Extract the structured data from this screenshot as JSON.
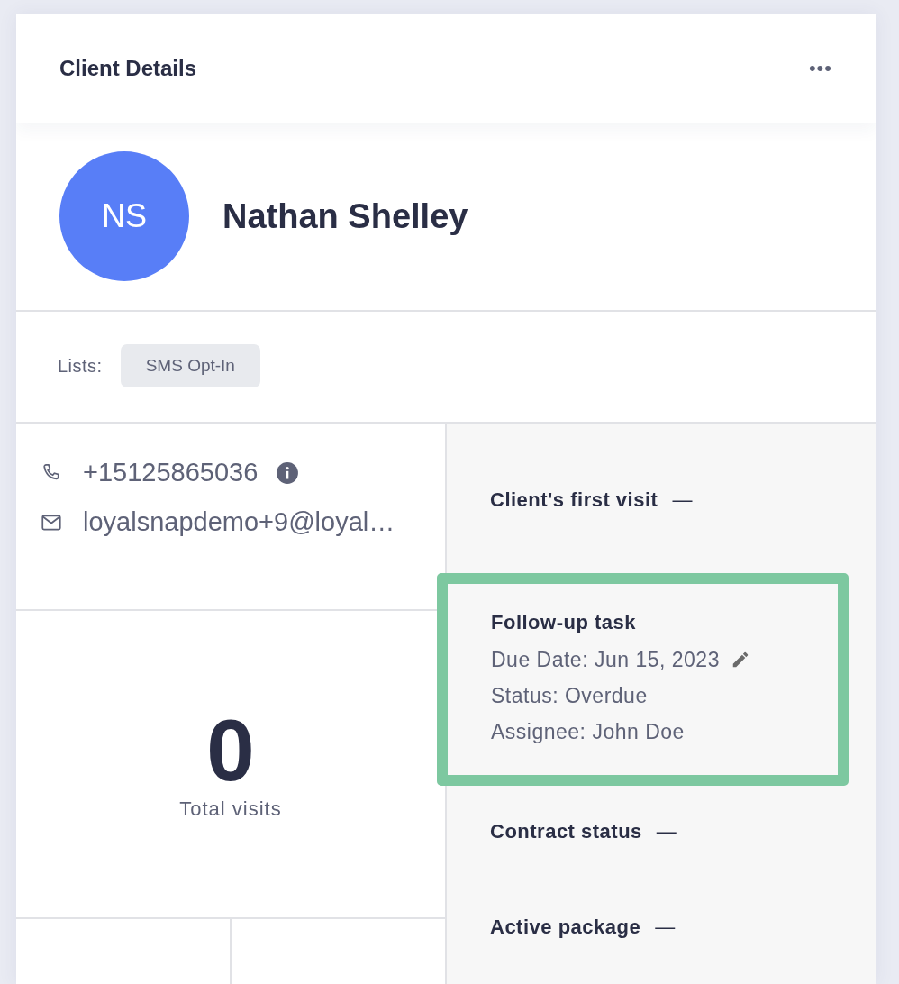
{
  "header": {
    "title": "Client Details",
    "menu": "•••"
  },
  "profile": {
    "initials": "NS",
    "name": "Nathan Shelley"
  },
  "lists": {
    "label": "Lists:",
    "tags": [
      "SMS Opt-In"
    ]
  },
  "contacts": [
    {
      "kind": "phone",
      "value": "+15125865036",
      "info": true
    },
    {
      "kind": "email",
      "value": "loyalsnapdemo+9@loyal…",
      "info": false
    }
  ],
  "visits": {
    "count": "0",
    "label": "Total visits"
  },
  "fields": [
    {
      "kind": "summary",
      "label": "Client's first visit",
      "value": "—",
      "highlighted": false
    },
    {
      "kind": "task",
      "label": "Follow-up task",
      "lines": [
        "Due Date: Jun 15, 2023",
        "Status: Overdue",
        "Assignee: John Doe"
      ],
      "highlighted": true
    },
    {
      "kind": "summary",
      "label": "Contract status",
      "value": "—",
      "highlighted": false
    },
    {
      "kind": "summary",
      "label": "Active package",
      "value": "—",
      "highlighted": false
    }
  ]
}
